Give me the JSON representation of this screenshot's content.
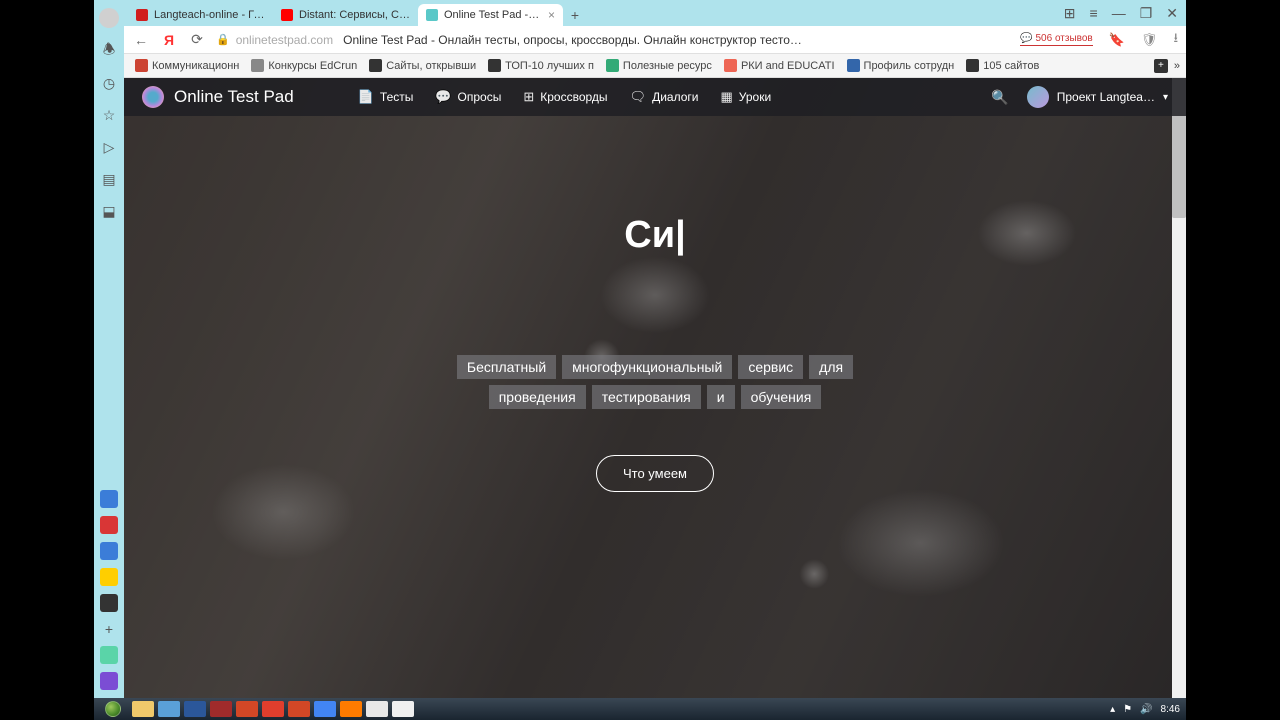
{
  "browser": {
    "tabs": [
      {
        "title": "Langteach-online - Главна",
        "favicon": "#d01d1d"
      },
      {
        "title": "Distant: Сервисы, Советы",
        "favicon": "#ff0000"
      },
      {
        "title": "Online Test Pad - Онла",
        "favicon": "#5ac8c8",
        "active": true
      }
    ],
    "window_controls": {
      "min": "—",
      "max": "❐",
      "close": "✕",
      "ext": "⊞",
      "menu": "≡"
    },
    "address": {
      "domain": "onlinetestpad.com",
      "title": "Online Test Pad - Онлайн тесты, опросы, кроссворды. Онлайн конструктор тесто…",
      "reviews_count": "506 отзывов"
    },
    "bookmarks": [
      {
        "label": "Коммуникационн",
        "color": "#c43"
      },
      {
        "label": "Конкурсы EdCrun",
        "color": "#888"
      },
      {
        "label": "Сайты, открывши",
        "color": "#333"
      },
      {
        "label": "ТОП-10 лучших п",
        "color": "#333"
      },
      {
        "label": "Полезные ресурс",
        "color": "#3a7"
      },
      {
        "label": "РКИ and EDUCATI",
        "color": "#e65"
      },
      {
        "label": "Профиль сотрудн",
        "color": "#36a"
      },
      {
        "label": "105 сайтов",
        "color": "#333"
      }
    ]
  },
  "site": {
    "brand": "Online Test Pad",
    "nav": [
      {
        "label": "Тесты",
        "icon": "📄"
      },
      {
        "label": "Опросы",
        "icon": "💬"
      },
      {
        "label": "Кроссворды",
        "icon": "⊞"
      },
      {
        "label": "Диалоги",
        "icon": "🗨"
      },
      {
        "label": "Уроки",
        "icon": "▦"
      }
    ],
    "user": "Проект Langtea…",
    "hero": {
      "typed": "Си|",
      "subtitle_words": [
        "Бесплатный",
        "многофункциональный",
        "сервис",
        "для",
        "проведения",
        "тестирования",
        "и",
        "обучения"
      ],
      "cta": "Что умеем"
    }
  },
  "taskbar": {
    "apps": [
      {
        "c": "#f0c96b"
      },
      {
        "c": "#5aa0d8"
      },
      {
        "c": "#2b579a"
      },
      {
        "c": "#a02b2b"
      },
      {
        "c": "#d24726"
      },
      {
        "c": "#e03e2d"
      },
      {
        "c": "#d24726"
      },
      {
        "c": "#4285f4"
      },
      {
        "c": "#ff7b00"
      },
      {
        "c": "#e8e8e8"
      },
      {
        "c": "#f0f0f0"
      }
    ],
    "time": "8:46"
  },
  "sidebar_bottom": [
    {
      "c": "#3b7dd8"
    },
    {
      "c": "#d93636"
    },
    {
      "c": "#3b7dd8"
    },
    {
      "c": "#ffce00"
    },
    {
      "c": "#333"
    },
    {
      "c": "#5ad4a8"
    },
    {
      "c": "#7b4dd4"
    }
  ]
}
